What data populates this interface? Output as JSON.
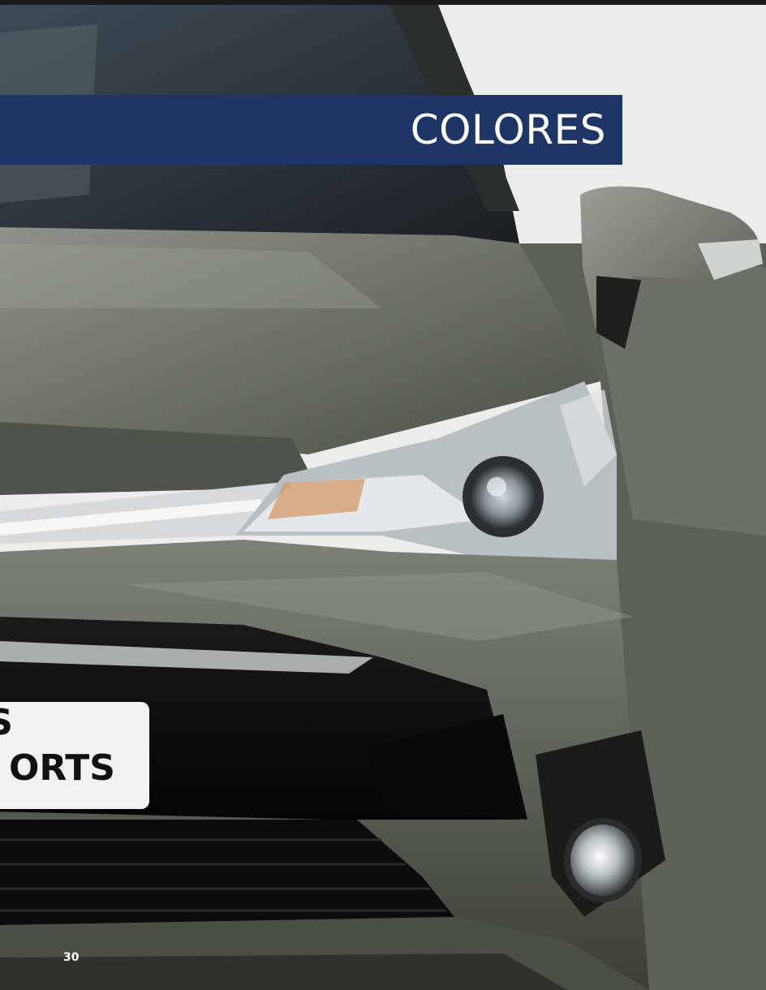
{
  "header": {
    "title": "COLORES"
  },
  "license_plate": {
    "line1": "S",
    "line2": "ORTS"
  },
  "footer": {
    "page_number": "30"
  },
  "colors": {
    "banner_background": "#1f3566",
    "banner_text": "#ffffff",
    "background": "#ececea",
    "car_body": "#5d6457"
  }
}
